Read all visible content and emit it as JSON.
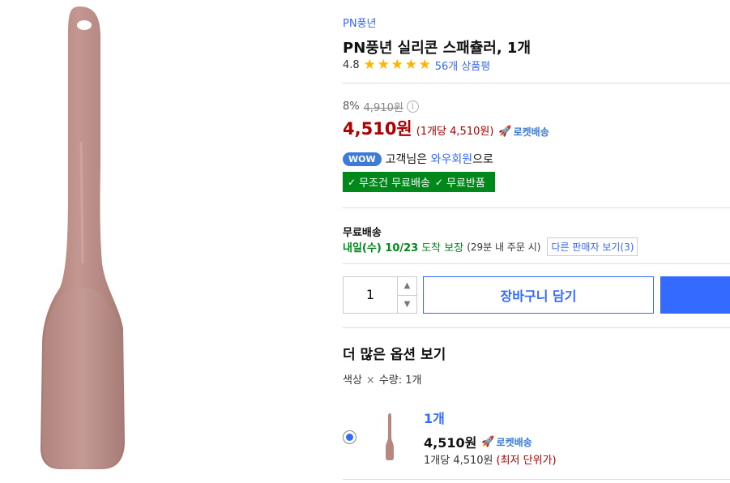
{
  "product": {
    "brand": "PN풍년",
    "title": "PN풍년 실리콘 스패츌러, 1개",
    "rating": "4.8",
    "stars": 5,
    "review_count": "56개 상품평"
  },
  "pricing": {
    "discount": "8%",
    "original_price": "4,910원",
    "info_icon": "i",
    "sale_price": "4,510원",
    "unit_price": "(1개당 4,510원)",
    "rocket_label": "로켓배송",
    "rocket_icon": "🚀"
  },
  "wow": {
    "badge": "WOW",
    "text_before": "고객님은",
    "link": "와우회원",
    "text_after": "으로"
  },
  "benefits": {
    "free_shipping": "무조건 무료배송",
    "free_return": "무료반품"
  },
  "shipping": {
    "label": "무료배송",
    "arrival": "내일(수) 10/23",
    "guarantee": "도착 보장",
    "cutoff": "(29분 내 주문 시)",
    "other_sellers": "다른 판매자 보기(3)"
  },
  "purchase": {
    "quantity": "1",
    "up_icon": "▲",
    "down_icon": "▼",
    "cart_label": "장바구니 담기"
  },
  "options": {
    "title": "더 많은 옵션 보기",
    "spec_label": "색상",
    "spec_sep": "×",
    "spec_qty": "수량: 1개",
    "item": {
      "name": "1개",
      "price": "4,510원",
      "rocket_label": "로켓배송",
      "unit_price": "1개당 4,510원",
      "lowest_label": "(최저 단위가)"
    }
  },
  "colors": {
    "brand_blue": "#346aff",
    "price_red": "#ae0000",
    "green": "#00891a",
    "spatula": "#b88c86"
  }
}
